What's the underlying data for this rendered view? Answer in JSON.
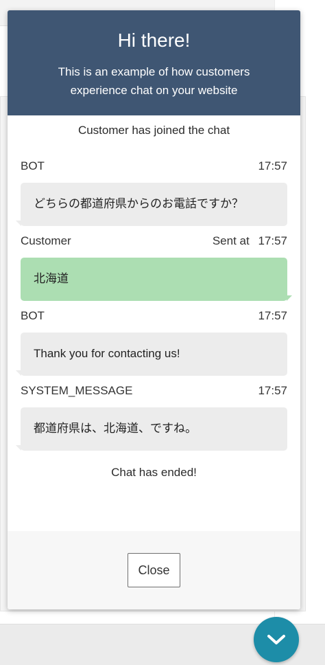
{
  "header": {
    "title": "Hi there!",
    "subtitle": "This is an example of how customers experience chat on your website"
  },
  "events": {
    "joined": "Customer has joined the chat",
    "ended": "Chat has ended!"
  },
  "messages": [
    {
      "sender": "BOT",
      "sent_prefix": "",
      "time": "17:57",
      "text": "どちらの都道府県からのお電話ですか？",
      "direction": "incoming"
    },
    {
      "sender": "Customer",
      "sent_prefix": "Sent at",
      "time": "17:57",
      "text": "北海道",
      "direction": "outgoing"
    },
    {
      "sender": "BOT",
      "sent_prefix": "",
      "time": "17:57",
      "text": "Thank you for contacting us!",
      "direction": "incoming"
    },
    {
      "sender": "SYSTEM_MESSAGE",
      "sent_prefix": "",
      "time": "17:57",
      "text": "都道府県は、北海道、ですね。",
      "direction": "incoming"
    }
  ],
  "footer": {
    "close_label": "Close"
  },
  "colors": {
    "header_bg": "#3f5673",
    "incoming_bubble": "#ececec",
    "outgoing_bubble": "#acdeb2",
    "toggle_bg": "#1d8da8"
  },
  "icons": {
    "toggle": "chevron-down-icon"
  }
}
